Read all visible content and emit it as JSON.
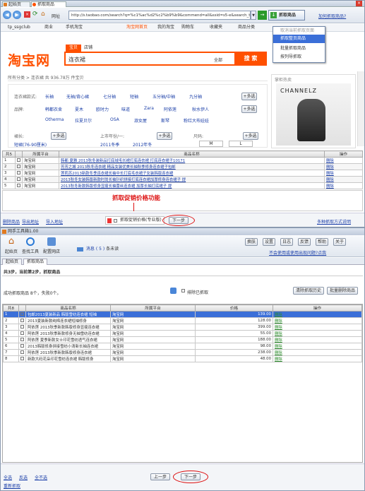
{
  "browser": {
    "tab_home": "起始页",
    "tab_active": "抓取商品",
    "addr_label": "网址",
    "url": "http://s.taobao.com/search?q=%c1%ac%d2%c2%b9%b9&commend=all&ssid=s5-e&search_ty",
    "grab_btn": "抓取商品",
    "fav_link": "加何抓取商品?",
    "menu": [
      "取消当前抓取页面",
      "抓取整页商品",
      "批量抓取商品",
      "按列导抓取"
    ]
  },
  "bookmarks": {
    "items": [
      "tp_ssgclub",
      "商业",
      "手机淘宝"
    ],
    "right": [
      "淘宝网首页",
      "我的淘宝",
      "购物车",
      "收藏夹",
      "商品分类",
      "卖家中心"
    ]
  },
  "taobao": {
    "logo": "淘宝网",
    "tab_baobei": "宝贝",
    "tab_shop": "店铺",
    "query": "连衣裙",
    "scope": "全部",
    "search_btn": "搜 索",
    "breadcrumb": "所有分类 > 连衣裙 共 936.78万 件宝贝",
    "filter1_label": "连衣裙款式:",
    "filter1": [
      "长袖",
      "无袖/背心裙",
      "七分袖",
      "短袖",
      "五分袖/中袖",
      "九分袖",
      "+多选"
    ],
    "filter2_label": "品牌:",
    "filter2": [
      "韩都衣舍",
      "夏木",
      "欧时力",
      "味道",
      "Zara",
      "阿依莲",
      "秋水伊人",
      "+多选"
    ],
    "filter3": [
      "Otherma",
      "拉夏贝尔",
      "OSA",
      "淑女屋",
      "斯琴",
      "粉红大布娃娃"
    ],
    "ad_label": "掌柜热卖",
    "ad_brand": "CHANNELZ",
    "sort_a": "裙长:",
    "sort_b": "上市年份/一:",
    "sort_c": "尺码:",
    "row2": [
      "短裙(76-90厘米)",
      "2011冬季",
      "2012年冬",
      "M",
      "L"
    ]
  },
  "top_table": {
    "headers": [
      "共5",
      "",
      "所属平台",
      "商品名称",
      "操作"
    ],
    "rows": [
      {
        "n": "1",
        "p": "淘宝网",
        "name": "韩都 夏雅 2013秋冬装新品打底绒毛长裙打底连衣裙 打底连衣裙子10171",
        "op": "删除"
      },
      {
        "n": "2",
        "p": "淘宝网",
        "name": "芳芳之城 2013秋冬连衣裙 精品女装优美长袖秋季修身连衣裙子包邮",
        "op": "删除"
      },
      {
        "n": "3",
        "p": "淘宝网",
        "name": "莲莉苏2013新款冬季连衣裙长袖中长打底毛衣裙子女装韩版连衣裙",
        "op": "删除"
      },
      {
        "n": "4",
        "p": "淘宝网",
        "name": "2013秋冬女装韩版新款时尚长袖针织拼接打底连衣裙加厚修身连衣裙子 提",
        "op": "删除"
      },
      {
        "n": "5",
        "p": "淘宝网",
        "name": "2013秋冬新款韩版修身显瘦长袖蕾丝连衣裙 加厚长袖打底裙子 提",
        "op": "删除"
      }
    ]
  },
  "annotation": "抓取促销价格功能",
  "bar1": {
    "del": "删除商品",
    "export": "导出地址",
    "import": "导入地址",
    "promo": "抓取促销价格(专业版)",
    "next": "下一步",
    "right": "多种抓取方式说明"
  },
  "tool": {
    "title": "网手工具箱1.00",
    "home": "起始页",
    "find": "查找工具",
    "settings": "配置网店",
    "msg": "消息",
    "msg_count": "( 5 )",
    "msg_tail": "条未读",
    "btns": [
      "换肤",
      "设置",
      "日志",
      "反馈",
      "帮助",
      "关于"
    ],
    "hint": "不会使用或使用出现问题?点我",
    "tab_home": "起始页",
    "tab_active": "抓取商品",
    "step": "共3步，当前第2步，抓取商品",
    "result": "成功抓取商品 8个，失败0个。",
    "excl": "排除已抓取",
    "clear_btn": "清除抓取历史",
    "batch_btn": "批量删除商品"
  },
  "bottom_table": {
    "headers": [
      "共8",
      "",
      "商品名称",
      "所属平台",
      "价格",
      "操作"
    ],
    "rows": [
      {
        "n": "1",
        "name": "包邮2013夏装新品 韩版雪纺连衣裙 短袖",
        "p": "淘宝网",
        "price": "139.00",
        "op": "删除",
        "sel": true
      },
      {
        "n": "2",
        "name": "2013夏装新款纯棉连衣裙短袖修身",
        "p": "淘宝网",
        "price": "128.00",
        "op": "删除"
      },
      {
        "n": "3",
        "name": "阿依莲 2013秋季新款韩版修身显瘦连衣裙",
        "p": "淘宝网",
        "price": "399.00",
        "op": "删除"
      },
      {
        "n": "4",
        "name": "阿依莲 2013秋季新款修身无袖雪纺连衣裙",
        "p": "淘宝网",
        "price": "55.00",
        "op": "删除"
      },
      {
        "n": "5",
        "name": "阿依莲 夏季新款女士印花雪纺透气连衣裙",
        "p": "淘宝网",
        "price": "188.00",
        "op": "删除"
      },
      {
        "n": "6",
        "name": "2013韩版修身拼接雪纺小清新长袖连衣裙",
        "p": "淘宝网",
        "price": "98.00",
        "op": "删除"
      },
      {
        "n": "7",
        "name": "阿依莲 2013秋季新款韩版修身连衣裙",
        "p": "淘宝网",
        "price": "238.00",
        "op": "删除"
      },
      {
        "n": "8",
        "name": "新款大码花朵印花雪纺连衣裙 韩版修身",
        "p": "淘宝网",
        "price": "48.00",
        "op": "删除"
      }
    ]
  },
  "footer": {
    "all": "全选",
    "inverse": "反选",
    "none": "全不选",
    "again": "重新抓取",
    "prev": "上一步",
    "next": "下一步"
  },
  "colors": {
    "tb_orange": "#ff5000",
    "link": "#1a3ea8",
    "red": "#d11111",
    "green": "#3a9a3a"
  }
}
